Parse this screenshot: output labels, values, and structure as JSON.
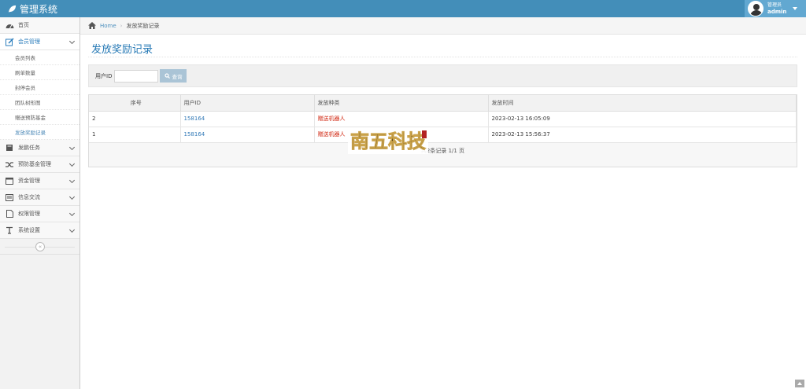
{
  "app": {
    "title": "管理系统"
  },
  "user": {
    "greeting": "管理员",
    "name": "admin"
  },
  "sidebar": {
    "items": [
      {
        "label": "首页",
        "icon": "tachometer-icon"
      },
      {
        "label": "会员管理",
        "icon": "edit-icon",
        "children": [
          {
            "label": "会员列表"
          },
          {
            "label": "刷单数量"
          },
          {
            "label": "封停会员"
          },
          {
            "label": "团队树形图"
          },
          {
            "label": "赠送预防基金"
          },
          {
            "label": "发放奖励记录"
          }
        ]
      },
      {
        "label": "发鹏任务",
        "icon": "book-icon"
      },
      {
        "label": "预防基金管理",
        "icon": "random-icon"
      },
      {
        "label": "资金管理",
        "icon": "calendar-icon"
      },
      {
        "label": "信息交流",
        "icon": "list-alt-icon"
      },
      {
        "label": "权限管理",
        "icon": "file-icon"
      },
      {
        "label": "系统设置",
        "icon": "text-icon"
      }
    ]
  },
  "breadcrumb": {
    "home": "Home",
    "current": "发放奖励记录"
  },
  "page": {
    "title": "发放奖励记录"
  },
  "search": {
    "label": "用户ID",
    "value": "",
    "button": "查询"
  },
  "table": {
    "headers": [
      "序号",
      "用户ID",
      "发放种类",
      "发放时间"
    ],
    "rows": [
      {
        "no": "2",
        "user_id": "158164",
        "type": "赠送机器人",
        "time": "2023-02-13 16:05:09"
      },
      {
        "no": "1",
        "user_id": "158164",
        "type": "赠送机器人",
        "time": "2023-02-13 15:56:37"
      }
    ],
    "footer": "共2条记录 1/1 页"
  },
  "watermark": {
    "text": "南五科技"
  },
  "colors": {
    "navbar": "#438eb9",
    "accent": "#2679b5",
    "red": "#d12610"
  }
}
